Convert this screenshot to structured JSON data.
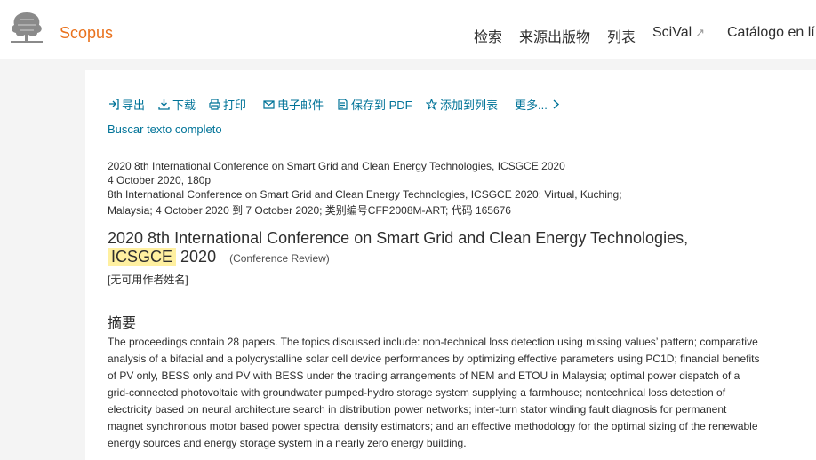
{
  "header": {
    "brand": "Scopus",
    "nav": [
      "检索",
      "来源出版物",
      "列表",
      "SciVal",
      "Catálogo en lí"
    ],
    "external_icon": "↗"
  },
  "toolbar": {
    "items": [
      {
        "label": "导出",
        "icon": "export-icon"
      },
      {
        "label": "下载",
        "icon": "download-icon"
      },
      {
        "label": "打印",
        "icon": "print-icon"
      },
      {
        "label": "电子邮件",
        "icon": "email-icon"
      },
      {
        "label": "保存到 PDF",
        "icon": "pdf-icon"
      },
      {
        "label": "添加到列表",
        "icon": "star-icon"
      },
      {
        "label": "更多...",
        "icon": "chevron-right-icon"
      }
    ],
    "full_text_link": "Buscar texto completo"
  },
  "source": {
    "lines": [
      "2020 8th International Conference on Smart Grid and Clean Energy Technologies, ICSGCE 2020",
      "4 October 2020, 180p",
      "8th International Conference on Smart Grid and Clean Energy Technologies, ICSGCE 2020; Virtual, Kuching;",
      "Malaysia; 4 October 2020 到 7 October 2020; 类别编号CFP2008M-ART; 代码 165676"
    ]
  },
  "document": {
    "title_line1": "2020 8th International Conference on Smart Grid and Clean Energy Technologies,",
    "title_highlight": "ICSGCE",
    "title_year": "2020",
    "doc_type": "(Conference Review)",
    "authors": "[无可用作者姓名]"
  },
  "abstract": {
    "heading": "摘要",
    "lines": [
      "The proceedings contain 28 papers. The topics discussed include: non-technical loss detection using missing values’ pattern; comparative",
      "analysis of a bifacial and a polycrystalline solar cell device performances by optimizing effective parameters using PC1D; financial benefits",
      "of PV only, BESS only and PV with BESS under the trading arrangements of NEM and ETOU in Malaysia; optimal power dispatch of a",
      "grid-connected photovoltaic with groundwater pumped-hydro storage system supplying a farmhouse; nontechnical loss detection of",
      "electricity based on neural architecture search in distribution power networks; inter-turn stator winding fault diagnosis for permanent",
      "magnet synchronous motor based power spectral density estimators; and an effective methodology for the optimal sizing of the renewable",
      "energy sources and energy storage system in a nearly zero energy building."
    ]
  },
  "colors": {
    "brand": "#e9711c",
    "link": "#007398",
    "highlight": "#fff0a0"
  }
}
